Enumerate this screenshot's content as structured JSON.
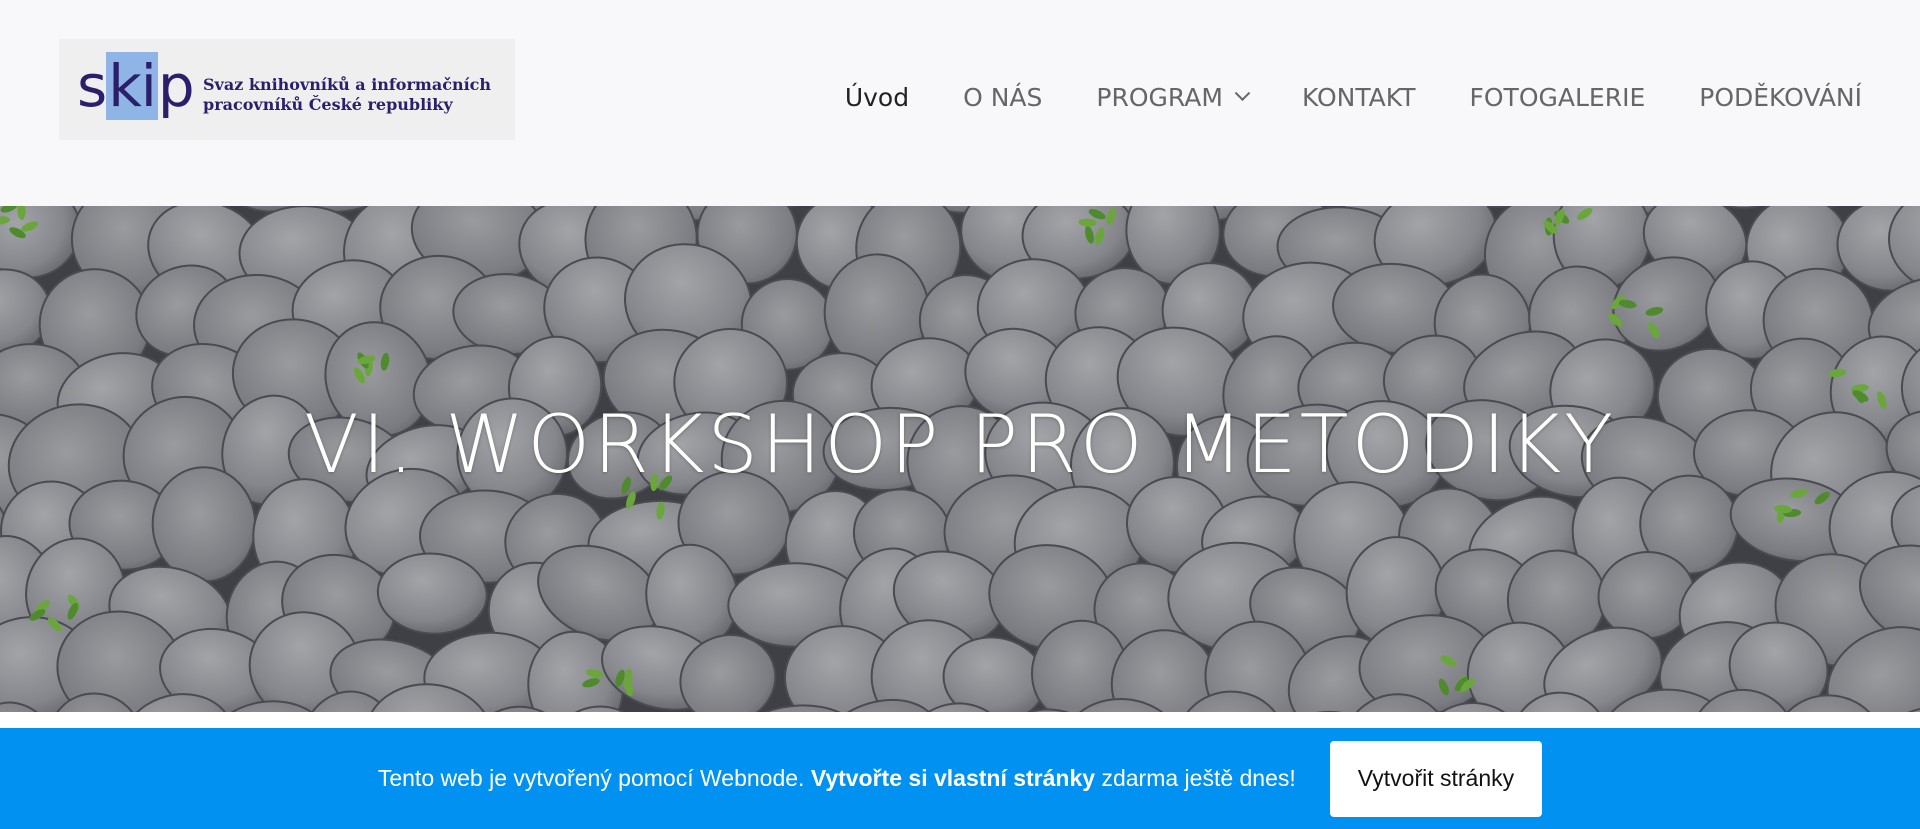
{
  "logo": {
    "mark_pre": "s",
    "mark_hl": "ki",
    "mark_post": "p",
    "line1": "Svaz knihovníků a informačních",
    "line2": "pracovníků České republiky"
  },
  "nav": {
    "items": [
      {
        "label": "Úvod"
      },
      {
        "label": "O NÁS"
      },
      {
        "label": "PROGRAM"
      },
      {
        "label": "KONTAKT"
      },
      {
        "label": "FOTOGALERIE"
      },
      {
        "label": "PODĚKOVÁNÍ"
      }
    ]
  },
  "hero": {
    "title": "VI. WORKSHOP PRO METODIKY"
  },
  "banner": {
    "text_pre": "Tento web je vytvořený pomocí Webnode.",
    "text_bold": "Vytvořte si vlastní stránky",
    "text_post": "zdarma ještě dnes!",
    "button": "Vytvořit stránky"
  },
  "colors": {
    "header_bg": "#f8f7fa",
    "logo_navy": "#2b1f6b",
    "banner_blue": "#0191f0",
    "stone_gray": "#8e8f94"
  }
}
